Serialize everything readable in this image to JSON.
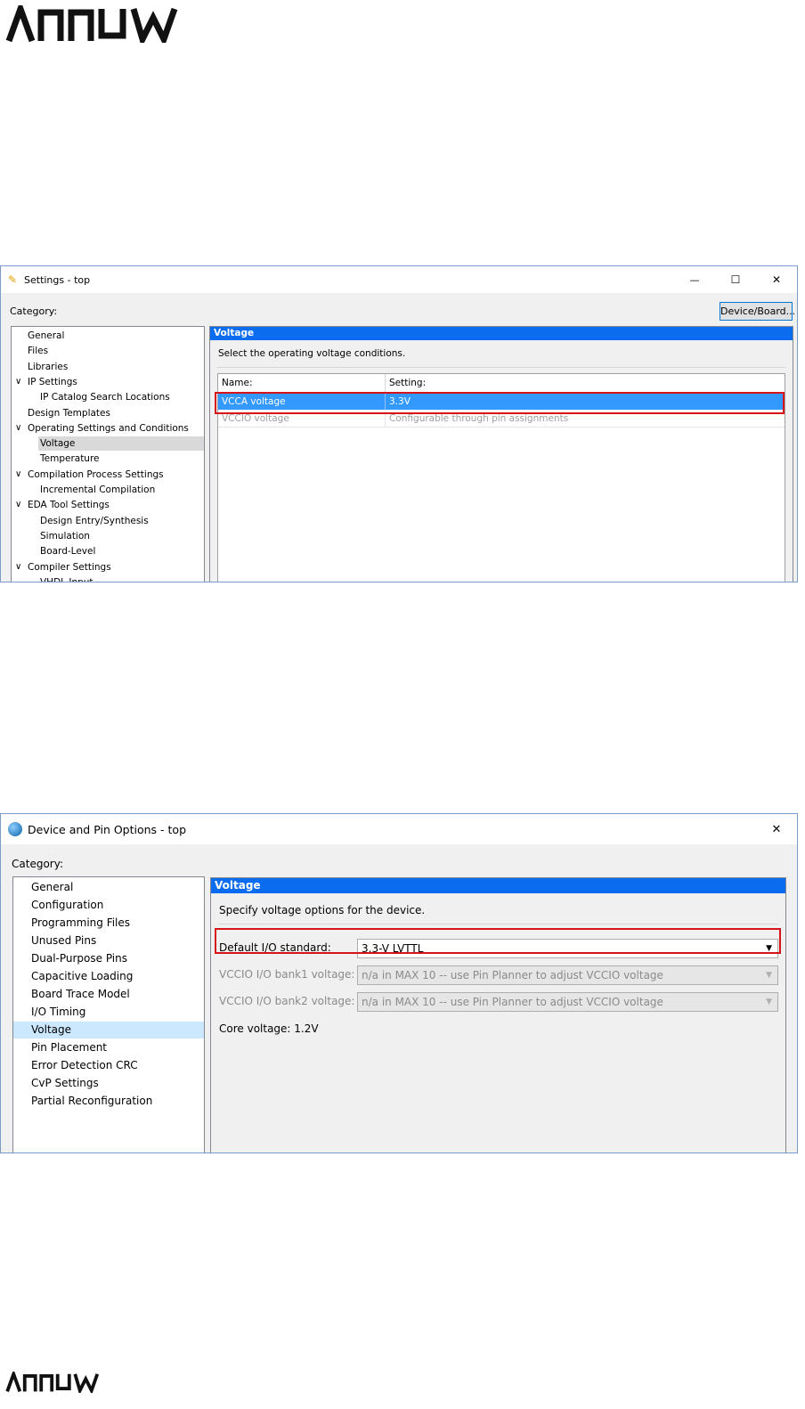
{
  "brand": {
    "logo_text": "ARROW"
  },
  "settings_window": {
    "title": "Settings - top",
    "controls": {
      "minimize": "—",
      "maximize": "☐",
      "close": "✕"
    },
    "category_label": "Category:",
    "device_board_button": "Device/Board...",
    "tree": [
      {
        "label": "General",
        "level": 0,
        "expanded": false,
        "selected": false
      },
      {
        "label": "Files",
        "level": 0,
        "expanded": false,
        "selected": false
      },
      {
        "label": "Libraries",
        "level": 0,
        "expanded": false,
        "selected": false
      },
      {
        "label": "IP Settings",
        "level": 0,
        "expanded": true,
        "selected": false
      },
      {
        "label": "IP Catalog Search Locations",
        "level": 1,
        "expanded": false,
        "selected": false
      },
      {
        "label": "Design Templates",
        "level": 0,
        "expanded": false,
        "selected": false
      },
      {
        "label": "Operating Settings and Conditions",
        "level": 0,
        "expanded": true,
        "selected": false
      },
      {
        "label": "Voltage",
        "level": 1,
        "expanded": false,
        "selected": true
      },
      {
        "label": "Temperature",
        "level": 1,
        "expanded": false,
        "selected": false
      },
      {
        "label": "Compilation Process Settings",
        "level": 0,
        "expanded": true,
        "selected": false
      },
      {
        "label": "Incremental Compilation",
        "level": 1,
        "expanded": false,
        "selected": false
      },
      {
        "label": "EDA Tool Settings",
        "level": 0,
        "expanded": true,
        "selected": false
      },
      {
        "label": "Design Entry/Synthesis",
        "level": 1,
        "expanded": false,
        "selected": false
      },
      {
        "label": "Simulation",
        "level": 1,
        "expanded": false,
        "selected": false
      },
      {
        "label": "Board-Level",
        "level": 1,
        "expanded": false,
        "selected": false
      },
      {
        "label": "Compiler Settings",
        "level": 0,
        "expanded": true,
        "selected": false
      },
      {
        "label": "VHDL Input",
        "level": 1,
        "expanded": false,
        "selected": false
      }
    ],
    "panel_title": "Voltage",
    "panel_description": "Select the operating voltage conditions.",
    "table": {
      "columns": [
        "Name:",
        "Setting:"
      ],
      "rows": [
        {
          "name": "VCCA voltage",
          "setting": "3.3V",
          "selected": true,
          "disabled": false
        },
        {
          "name": "VCCIO voltage",
          "setting": "Configurable through pin assignments",
          "selected": false,
          "disabled": true
        }
      ]
    }
  },
  "device_pin_window": {
    "title": "Device and Pin Options - top",
    "controls": {
      "close": "✕"
    },
    "category_label": "Category:",
    "list": [
      {
        "label": "General",
        "selected": false
      },
      {
        "label": "Configuration",
        "selected": false
      },
      {
        "label": "Programming Files",
        "selected": false
      },
      {
        "label": "Unused Pins",
        "selected": false
      },
      {
        "label": "Dual-Purpose Pins",
        "selected": false
      },
      {
        "label": "Capacitive Loading",
        "selected": false
      },
      {
        "label": "Board Trace Model",
        "selected": false
      },
      {
        "label": "I/O Timing",
        "selected": false
      },
      {
        "label": "Voltage",
        "selected": true
      },
      {
        "label": "Pin Placement",
        "selected": false
      },
      {
        "label": "Error Detection CRC",
        "selected": false
      },
      {
        "label": "CvP Settings",
        "selected": false
      },
      {
        "label": "Partial Reconfiguration",
        "selected": false
      }
    ],
    "panel_title": "Voltage",
    "panel_description": "Specify voltage options for the device.",
    "fields": [
      {
        "label": "Default I/O standard:",
        "value": "3.3-V LVTTL",
        "disabled": false
      },
      {
        "label": "VCCIO I/O bank1 voltage:",
        "value": "n/a in MAX 10 -- use Pin Planner to adjust VCCIO voltage",
        "disabled": true
      },
      {
        "label": "VCCIO I/O bank2 voltage:",
        "value": "n/a in MAX 10 -- use Pin Planner to adjust VCCIO voltage",
        "disabled": true
      }
    ],
    "core_voltage": "Core voltage: 1.2V"
  },
  "colors": {
    "accent": "#0c6cf0",
    "selection_blue": "#3399ff",
    "highlight_red": "#d7141a",
    "tree_selected_bg": "#d9d9d9",
    "list_selected_bg": "#cce8ff"
  }
}
